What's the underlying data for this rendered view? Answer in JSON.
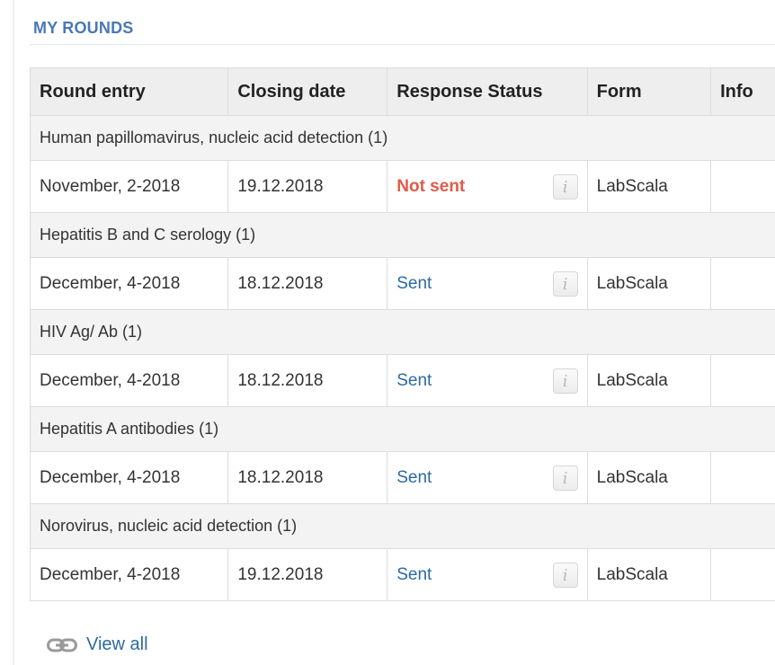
{
  "section": {
    "title": "MY ROUNDS"
  },
  "table": {
    "headers": {
      "round_entry": "Round entry",
      "closing_date": "Closing date",
      "response_status": "Response Status",
      "form": "Form",
      "info": "Info"
    },
    "groups": [
      {
        "name": "Human papillomavirus, nucleic acid detection (1)",
        "entry": {
          "round": "November, 2-2018",
          "closing_date": "19.12.2018",
          "status": "Not sent",
          "form": "LabScala"
        }
      },
      {
        "name": "Hepatitis B and C serology (1)",
        "entry": {
          "round": "December, 4-2018",
          "closing_date": "18.12.2018",
          "status": "Sent",
          "form": "LabScala"
        }
      },
      {
        "name": "HIV Ag/ Ab (1)",
        "entry": {
          "round": "December, 4-2018",
          "closing_date": "18.12.2018",
          "status": "Sent",
          "form": "LabScala"
        }
      },
      {
        "name": "Hepatitis A antibodies (1)",
        "entry": {
          "round": "December, 4-2018",
          "closing_date": "18.12.2018",
          "status": "Sent",
          "form": "LabScala"
        }
      },
      {
        "name": "Norovirus, nucleic acid detection (1)",
        "entry": {
          "round": "December, 4-2018",
          "closing_date": "19.12.2018",
          "status": "Sent",
          "form": "LabScala"
        }
      }
    ],
    "info_icon": {
      "icon": "info-icon",
      "glyph": "i"
    }
  },
  "footer": {
    "view_all_label": "View all",
    "icon": "link-icon"
  },
  "colors": {
    "title": "#4a78b5",
    "not_sent": "#e05a4a",
    "sent": "#2c6aa0",
    "link": "#2c6aa0"
  }
}
